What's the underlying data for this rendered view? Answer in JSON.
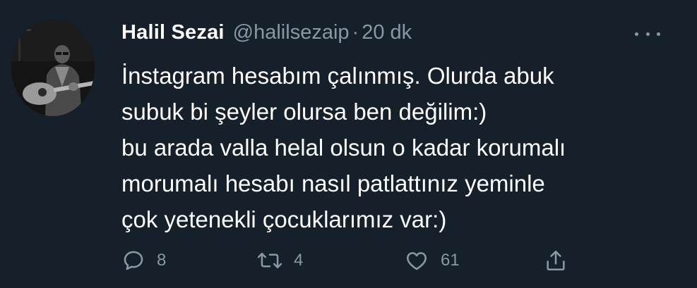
{
  "author": {
    "name": "Halil Sezai",
    "handle": "@halilsezaip",
    "separator": "·",
    "time": "20 dk"
  },
  "tweet": {
    "lines": [
      "İnstagram hesabım çalınmış. Olurda abuk",
      "subuk bi şeyler olursa ben değilim:)",
      "bu arada valla helal olsun o kadar korumalı",
      "morumalı hesabı nasıl patlattınız yeminle",
      "çok yetenekli çocuklarımız var:)"
    ]
  },
  "actions": {
    "reply": {
      "icon": "reply-icon",
      "count": "8"
    },
    "retweet": {
      "icon": "retweet-icon",
      "count": "4"
    },
    "like": {
      "icon": "heart-icon",
      "count": "61"
    },
    "share": {
      "icon": "share-icon",
      "count": ""
    }
  },
  "colors": {
    "background": "#15202b",
    "text": "#ffffff",
    "secondary": "#8899a6"
  }
}
